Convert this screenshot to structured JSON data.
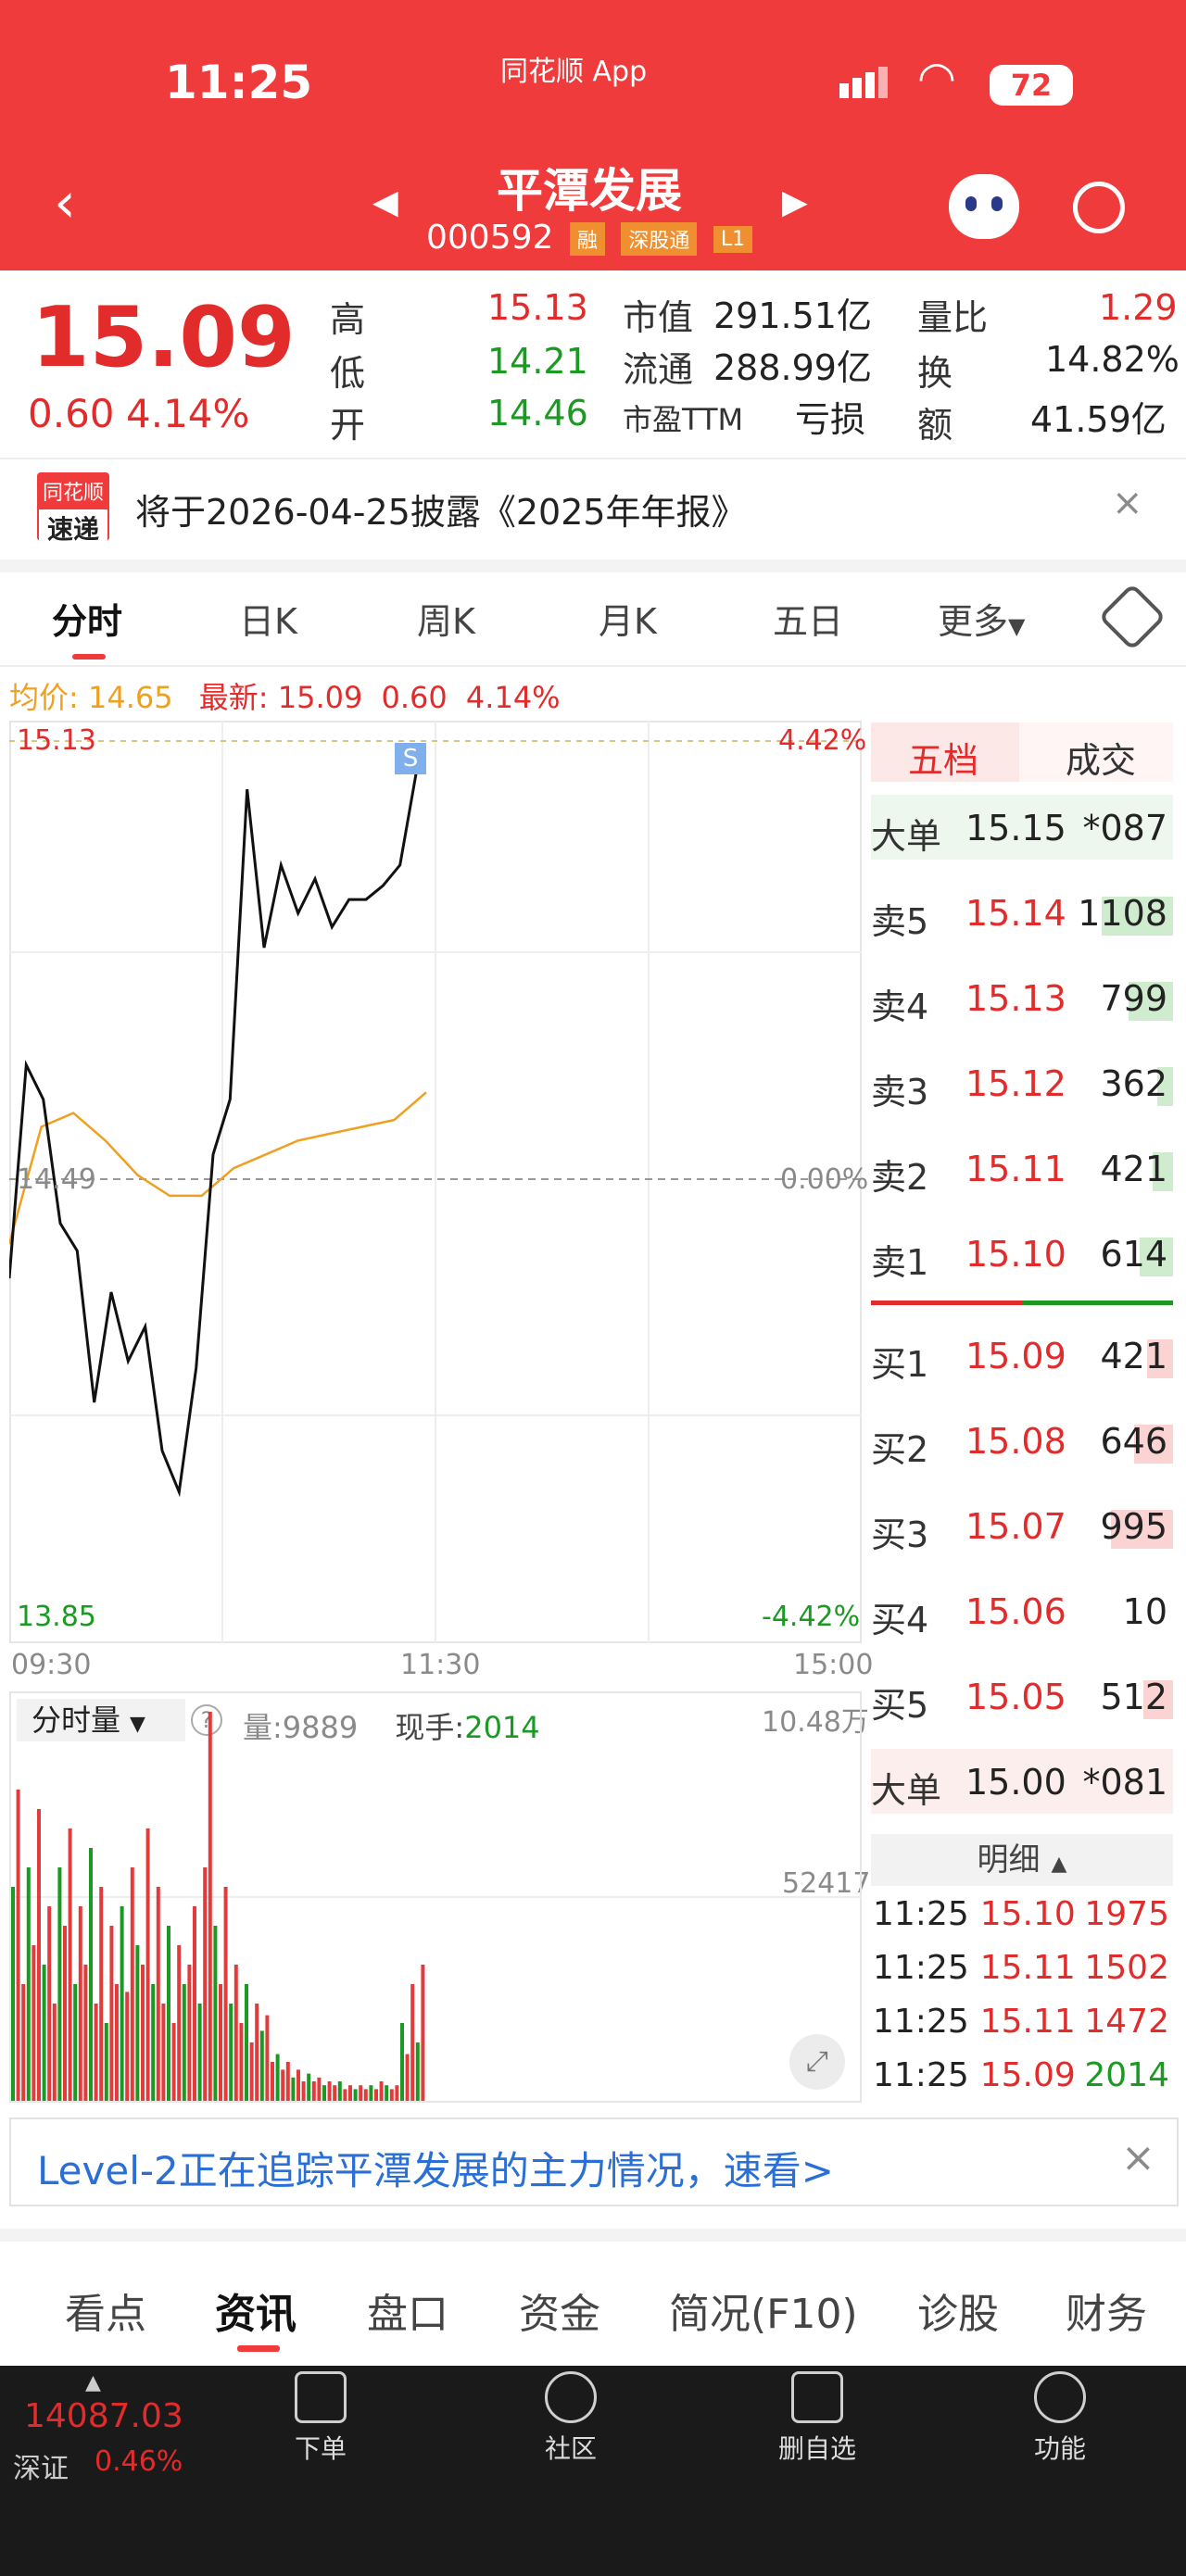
{
  "status": {
    "time": "11:25",
    "app_label": "同花顺 App",
    "battery": "72"
  },
  "header": {
    "title": "平潭发展",
    "code": "000592",
    "tags": [
      "融",
      "深股通",
      "L1"
    ]
  },
  "quote": {
    "price": "15.09",
    "change": "0.60",
    "change_pct": "4.14%",
    "high_label": "高",
    "high": "15.13",
    "low_label": "低",
    "low": "14.21",
    "open_label": "开",
    "open": "14.46",
    "mcap_label": "市值",
    "mcap": "291.51亿",
    "float_label": "流通",
    "float": "288.99亿",
    "pe_label": "市盈TTM",
    "pe": "亏损",
    "vr_label": "量比",
    "vr": "1.29",
    "turn_label": "换",
    "turn": "14.82%",
    "amt_label": "额",
    "amt": "41.59亿"
  },
  "notice": {
    "logo_top": "同花顺",
    "logo_bottom": "速递",
    "text": "将于2026-04-25披露《2025年年报》"
  },
  "ktabs": [
    "分时",
    "日K",
    "周K",
    "月K",
    "五日",
    "更多"
  ],
  "chart_info": {
    "avg_label": "均价:",
    "avg": "14.65",
    "latest_label": "最新:",
    "latest": "15.09",
    "chg": "0.60",
    "chg_pct": "4.14%"
  },
  "chart": {
    "y_top": "15.13",
    "y_mid": "14.49",
    "y_bot": "13.85",
    "pct_top": "4.42%",
    "pct_mid": "0.00%",
    "pct_bot": "-4.42%",
    "x_start": "09:30",
    "x_mid": "11:30",
    "x_end": "15:00",
    "marker": "S"
  },
  "chart_data": {
    "type": "line",
    "series": [
      {
        "name": "price",
        "values": [
          14.35,
          14.66,
          14.61,
          14.43,
          14.39,
          14.17,
          14.33,
          14.23,
          14.28,
          14.1,
          14.04,
          14.22,
          14.53,
          14.61,
          15.06,
          14.83,
          14.95,
          14.88,
          14.93,
          14.86,
          14.9,
          14.9,
          14.92,
          14.95,
          15.09
        ]
      },
      {
        "name": "avg",
        "values": [
          14.4,
          14.57,
          14.59,
          14.55,
          14.5,
          14.47,
          14.47,
          14.51,
          14.53,
          14.55,
          14.56,
          14.57,
          14.58,
          14.62
        ]
      }
    ],
    "ylim": [
      13.85,
      15.13
    ]
  },
  "volume": {
    "dropdown": "分时量",
    "vol_label": "量:",
    "vol": "9889",
    "hand_label": "现手:",
    "hand": "2014",
    "top": "10.48万",
    "mid": "52417"
  },
  "orderbook": {
    "tab_active": "五档",
    "tab_other": "成交",
    "big_top": {
      "label": "大单",
      "price": "15.15",
      "vol": "*087"
    },
    "asks": [
      {
        "label": "卖5",
        "price": "15.14",
        "vol": "1108",
        "fill": 0.55
      },
      {
        "label": "卖4",
        "price": "15.13",
        "vol": "799",
        "fill": 0.34
      },
      {
        "label": "卖3",
        "price": "15.12",
        "vol": "362",
        "fill": 0.12
      },
      {
        "label": "卖2",
        "price": "15.11",
        "vol": "421",
        "fill": 0.16
      },
      {
        "label": "卖1",
        "price": "15.10",
        "vol": "614",
        "fill": 0.26
      }
    ],
    "bids": [
      {
        "label": "买1",
        "price": "15.09",
        "vol": "421",
        "fill": 0.2
      },
      {
        "label": "买2",
        "price": "15.08",
        "vol": "646",
        "fill": 0.3
      },
      {
        "label": "买3",
        "price": "15.07",
        "vol": "995",
        "fill": 0.48
      },
      {
        "label": "买4",
        "price": "15.06",
        "vol": "10",
        "fill": 0
      },
      {
        "label": "买5",
        "price": "15.05",
        "vol": "512",
        "fill": 0.23
      }
    ],
    "big_bottom": {
      "label": "大单",
      "price": "15.00",
      "vol": "*081"
    },
    "detail_label": "明细",
    "deals": [
      {
        "time": "11:25",
        "price": "15.10",
        "vol": "1975"
      },
      {
        "time": "11:25",
        "price": "15.11",
        "vol": "1502"
      },
      {
        "time": "11:25",
        "price": "15.11",
        "vol": "1472"
      },
      {
        "time": "11:25",
        "price": "15.09",
        "vol": "2014"
      }
    ]
  },
  "level2": {
    "text": "Level-2正在追踪平潭发展的主力情况，速看>"
  },
  "bottom_tabs": [
    "看点",
    "资讯",
    "盘口",
    "资金",
    "简况(F10)",
    "诊股",
    "财务"
  ],
  "bottom_bar": {
    "index_value": "14087.03",
    "index_name": "深证",
    "index_pct": "0.46%",
    "items": [
      "下单",
      "社区",
      "删自选",
      "功能"
    ]
  },
  "colors": {
    "brand": "#ef3b3b",
    "up": "#e22b2b",
    "down": "#1a9a22",
    "avg": "#f0a020"
  }
}
